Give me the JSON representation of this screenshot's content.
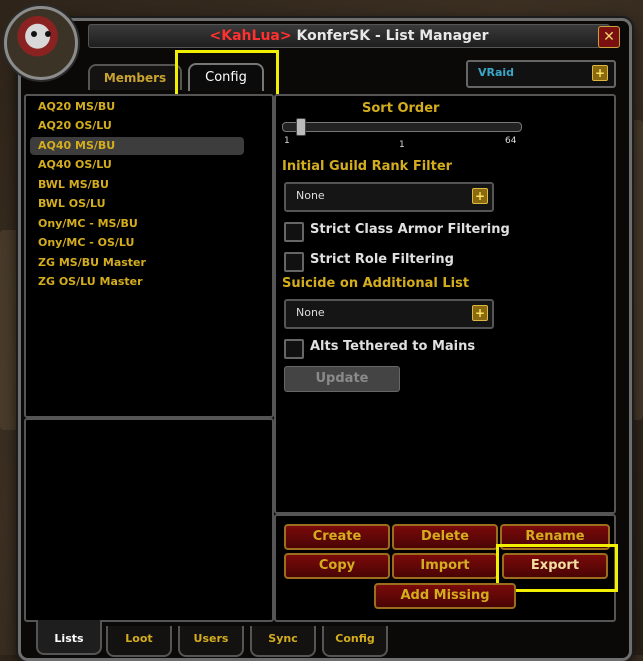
{
  "window": {
    "title_tag": "<KahLua>",
    "title_rest": " KonferSK - List Manager",
    "close_label": "✕"
  },
  "top_tabs": {
    "members_label": "Members",
    "config_label": "Config"
  },
  "raid_dropdown": {
    "value": "VRaid",
    "button_glyph": "+"
  },
  "lists": [
    {
      "label": "AQ20 MS/BU",
      "selected": false
    },
    {
      "label": "AQ20 OS/LU",
      "selected": false
    },
    {
      "label": "AQ40 MS/BU",
      "selected": true
    },
    {
      "label": "AQ40 OS/LU",
      "selected": false
    },
    {
      "label": "BWL MS/BU",
      "selected": false
    },
    {
      "label": "BWL OS/LU",
      "selected": false
    },
    {
      "label": "Ony/MC - MS/BU",
      "selected": false
    },
    {
      "label": "Ony/MC - OS/LU",
      "selected": false
    },
    {
      "label": "ZG MS/BU Master",
      "selected": false
    },
    {
      "label": "ZG OS/LU Master",
      "selected": false
    }
  ],
  "config": {
    "sort_order_label": "Sort Order",
    "slider_min": "1",
    "slider_mid": "1",
    "slider_max": "64",
    "slider_value": 1,
    "guild_rank_filter_label": "Initial Guild Rank Filter",
    "guild_rank_filter_value": "None",
    "strict_class_armor_label": "Strict Class Armor Filtering",
    "strict_class_armor_checked": false,
    "strict_role_label": "Strict Role Filtering",
    "strict_role_checked": false,
    "suicide_label": "Suicide on Additional List",
    "suicide_value": "None",
    "alts_tethered_label": "Alts Tethered to Mains",
    "alts_tethered_checked": false,
    "update_label": "Update"
  },
  "actions": {
    "create": "Create",
    "delete": "Delete",
    "rename": "Rename",
    "copy": "Copy",
    "import": "Import",
    "export": "Export",
    "add_missing": "Add Missing"
  },
  "bottom_tabs": {
    "lists": "Lists",
    "loot": "Loot",
    "users": "Users",
    "sync": "Sync",
    "config": "Config"
  },
  "colors": {
    "gold_text": "#d4ad1e",
    "title_tag": "#ff3030",
    "highlight": "#f0f000",
    "button_red": "#7a0a0a",
    "raid_blue": "#3aa6c8"
  }
}
